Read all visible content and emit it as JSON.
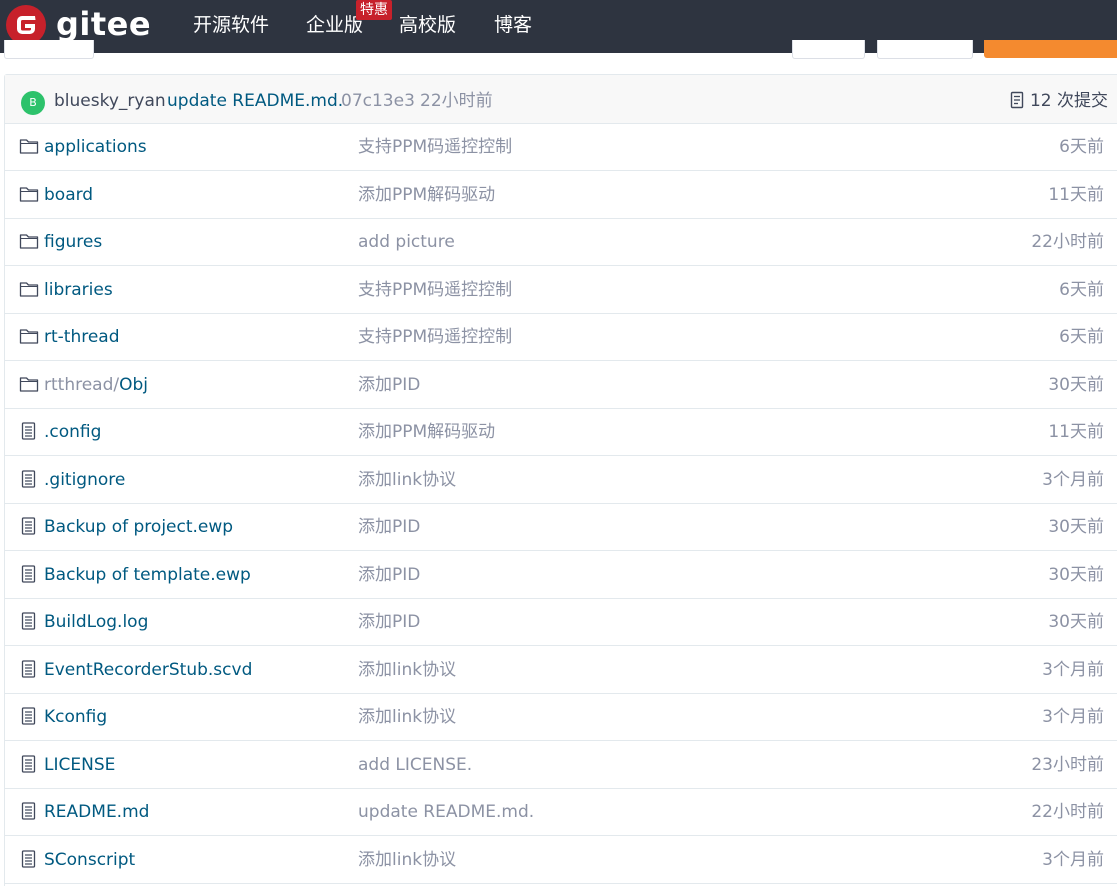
{
  "header": {
    "brand": "gitee",
    "nav": [
      {
        "label": "开源软件"
      },
      {
        "label": "企业版",
        "badge": "特惠"
      },
      {
        "label": "高校版"
      },
      {
        "label": "博客"
      }
    ]
  },
  "latest_commit": {
    "avatar_letter": "B",
    "author": "bluesky_ryan",
    "message": "update README.md.",
    "sha": "07c13e3",
    "time": "22小时前",
    "commits_label": "12 次提交"
  },
  "files": [
    {
      "type": "folder",
      "name": "applications",
      "message": "支持PPM码遥控控制",
      "time": "6天前"
    },
    {
      "type": "folder",
      "name": "board",
      "message": "添加PPM解码驱动",
      "time": "11天前"
    },
    {
      "type": "folder",
      "name": "figures",
      "message": "add picture",
      "time": "22小时前"
    },
    {
      "type": "folder",
      "name": "libraries",
      "message": "支持PPM码遥控控制",
      "time": "6天前"
    },
    {
      "type": "folder",
      "name": "rt-thread",
      "message": "支持PPM码遥控控制",
      "time": "6天前"
    },
    {
      "type": "folder",
      "name_prefix": "rtthread/",
      "name": "Obj",
      "message": "添加PID",
      "time": "30天前"
    },
    {
      "type": "file",
      "name": ".config",
      "message": "添加PPM解码驱动",
      "time": "11天前"
    },
    {
      "type": "file",
      "name": ".gitignore",
      "message": "添加link协议",
      "time": "3个月前"
    },
    {
      "type": "file",
      "name": "Backup of project.ewp",
      "message": "添加PID",
      "time": "30天前"
    },
    {
      "type": "file",
      "name": "Backup of template.ewp",
      "message": "添加PID",
      "time": "30天前"
    },
    {
      "type": "file",
      "name": "BuildLog.log",
      "message": "添加PID",
      "time": "30天前"
    },
    {
      "type": "file",
      "name": "EventRecorderStub.scvd",
      "message": "添加link协议",
      "time": "3个月前"
    },
    {
      "type": "file",
      "name": "Kconfig",
      "message": "添加link协议",
      "time": "3个月前"
    },
    {
      "type": "file",
      "name": "LICENSE",
      "message": "add LICENSE.",
      "time": "23小时前"
    },
    {
      "type": "file",
      "name": "README.md",
      "message": "update README.md.",
      "time": "22小时前"
    },
    {
      "type": "file",
      "name": "SConscript",
      "message": "添加link协议",
      "time": "3个月前"
    }
  ],
  "colors": {
    "header_bg": "#2e3440",
    "logo_red": "#c7212b",
    "link": "#005980",
    "muted": "#8c92a4",
    "accent_orange": "#f48a2f",
    "avatar_green": "#2dc26b"
  },
  "icons": {
    "folder": "folder-icon",
    "file": "file-text-icon",
    "commits": "commit-log-icon"
  }
}
